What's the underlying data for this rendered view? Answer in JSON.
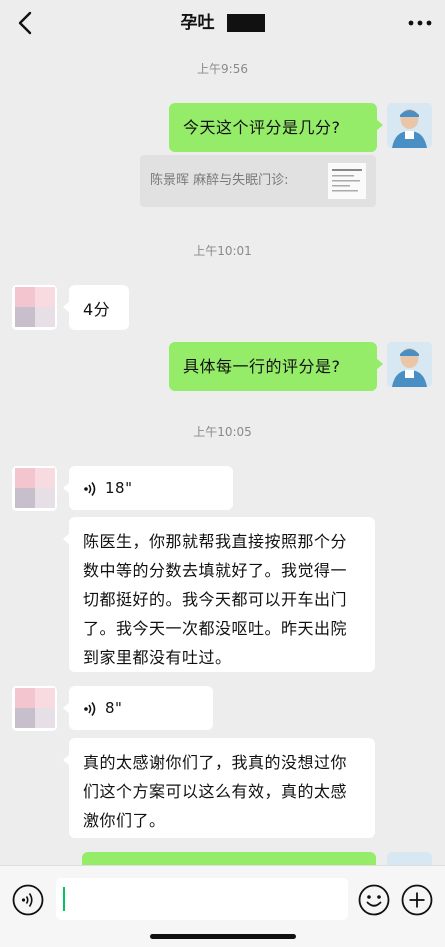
{
  "header": {
    "title": "孕吐"
  },
  "timestamps": [
    "上午9:56",
    "上午10:01",
    "上午10:05"
  ],
  "messages": {
    "q1": "今天这个评分是几分?",
    "quote": "陈景晖 麻醉与失眠门诊:",
    "a1": "4分",
    "q2": "具体每一行的评分是?",
    "voice1": "18\"",
    "text1": "陈医生，你那就帮我直接按照那个分数中等的分数去填就好了。我觉得一切都挺好的。我今天都可以开车出门了。我今天一次都没呕吐。昨天出院到家里都没有吐过。",
    "voice2": "8\"",
    "text2": "真的太感谢你们了，我真的没想过你们这个方案可以这么有效，真的太感激你们了。"
  },
  "input": {
    "value": ""
  },
  "colors": {
    "self_bubble": "#95ec69",
    "other_bubble": "#ffffff",
    "background": "#ededed",
    "caret": "#07c160"
  }
}
